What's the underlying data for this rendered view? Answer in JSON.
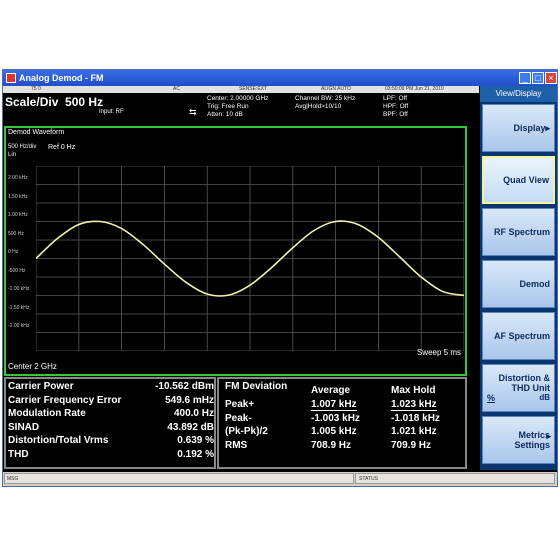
{
  "window": {
    "title": "Analog Demod - FM"
  },
  "statusline": {
    "ref_level": "75 0",
    "ac": "AC",
    "sense": "SENSE:EXT",
    "align": "ALIGN AUTO",
    "datetime": "03:50:09 PM Jun 21, 2010"
  },
  "header": {
    "scale_label": "Scale/Div",
    "scale_value": "500 Hz",
    "input": "Input: RF",
    "center": "Center: 2.00000 GHz",
    "trig": "Trig: Free Run",
    "atten": "Atten: 10 dB",
    "chan_bw": "Channel BW: 25 kHz",
    "avg_hold": "Avg|Hold>10/10",
    "lpf": "LPF: Off",
    "hpf": "HPF: Off",
    "bpf": "BPF: Off"
  },
  "panel": {
    "title": "Demod Waveform",
    "units": "500 Hz/div",
    "units2": "Lin",
    "ref": "Ref 0 Hz",
    "y_labels": [
      "2.00 kHz",
      "1.50 kHz",
      "1.00 kHz",
      "500 Hz",
      "0 Hz",
      "-500 Hz",
      "-1.00 kHz",
      "-1.50 kHz",
      "-2.00 kHz"
    ],
    "center": "Center  2 GHz",
    "sweep": "Sweep  5 ms"
  },
  "chart_data": {
    "type": "line",
    "title": "Demod Waveform",
    "xlabel": "",
    "ylabel": "",
    "ylim": [
      -2500,
      2500
    ],
    "x": [
      0,
      0.05,
      0.1,
      0.15,
      0.2,
      0.25,
      0.3,
      0.35,
      0.4,
      0.45,
      0.5,
      0.55,
      0.6,
      0.65,
      0.7,
      0.75,
      0.8,
      0.85,
      0.9,
      0.95,
      1.0
    ],
    "series": [
      {
        "values": [
          0,
          540,
          920,
          1000,
          810,
          380,
          -150,
          -640,
          -960,
          -990,
          -720,
          -250,
          290,
          760,
          1000,
          930,
          570,
          40,
          -500,
          -890,
          -1000
        ]
      }
    ],
    "grid": true
  },
  "measurements": [
    {
      "label": "Carrier Power",
      "value": "-10.562 dBm"
    },
    {
      "label": "Carrier Frequency Error",
      "value": "549.6 mHz"
    },
    {
      "label": "Modulation Rate",
      "value": "400.0 Hz"
    },
    {
      "label": "SINAD",
      "value": "43.892 dB"
    },
    {
      "label": "Distortion/Total Vrms",
      "value": "0.639 %"
    },
    {
      "label": "THD",
      "value": "0.192 %"
    }
  ],
  "fm_deviation": {
    "title": "FM Deviation",
    "col_average": "Average",
    "col_maxhold": "Max Hold",
    "rows": [
      {
        "label": "Peak+",
        "average": "1.007 kHz",
        "max": "1.023 kHz"
      },
      {
        "label": "Peak-",
        "average": "-1.003 kHz",
        "max": "-1.018 kHz"
      },
      {
        "label": "(Pk-Pk)/2",
        "average": "1.005 kHz",
        "max": "1.021 kHz"
      },
      {
        "label": "RMS",
        "average": "708.9 Hz",
        "max": "709.9 Hz"
      }
    ]
  },
  "menu": {
    "header": "View/Display",
    "display": "Display",
    "quad_view": "Quad View",
    "rf_spectrum": "RF Spectrum",
    "demod": "Demod",
    "af_spectrum": "AF Spectrum",
    "distortion_line1": "Distortion &",
    "distortion_line2": "THD Unit",
    "distortion_line3": "dB",
    "distortion_side": "%",
    "metrics_line1": "Metrics",
    "metrics_line2": "Settings"
  },
  "bottombar": {
    "msg": "MSG",
    "status": "STATUS"
  }
}
